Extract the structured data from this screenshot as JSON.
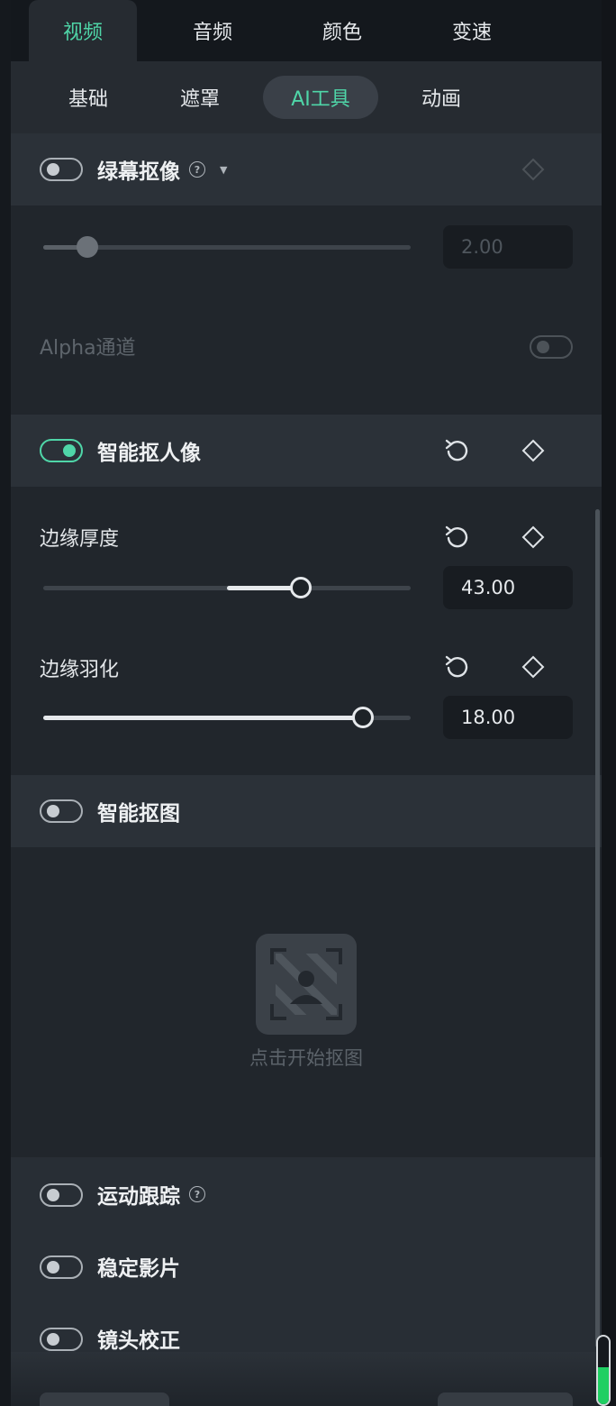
{
  "top_tabs": [
    {
      "label": "视频",
      "active": true
    },
    {
      "label": "音频",
      "active": false
    },
    {
      "label": "颜色",
      "active": false
    },
    {
      "label": "变速",
      "active": false
    }
  ],
  "sub_tabs": [
    {
      "label": "基础",
      "active": false
    },
    {
      "label": "遮罩",
      "active": false
    },
    {
      "label": "AI工具",
      "active": true
    },
    {
      "label": "动画",
      "active": false
    }
  ],
  "green_screen": {
    "title": "绿幕抠像",
    "enabled": false,
    "slider_value": "2.00",
    "slider_level": 0.12,
    "alpha_label": "Alpha通道",
    "alpha_enabled": false
  },
  "smart_portrait": {
    "title": "智能抠人像",
    "enabled": true,
    "edge_thickness": {
      "label": "边缘厚度",
      "value": "43.00",
      "level": 0.7
    },
    "edge_feather": {
      "label": "边缘羽化",
      "value": "18.00",
      "level": 0.87
    }
  },
  "smart_cutout": {
    "title": "智能抠图",
    "enabled": false,
    "placeholder": "点击开始抠图"
  },
  "motion_tracking": {
    "title": "运动跟踪",
    "enabled": false
  },
  "stabilize": {
    "title": "稳定影片",
    "enabled": false
  },
  "lens_correction": {
    "title": "镜头校正",
    "enabled": false
  },
  "colors": {
    "accent": "#4fd6a8",
    "meter": "#1fcf62"
  },
  "meter_level": 0.55
}
